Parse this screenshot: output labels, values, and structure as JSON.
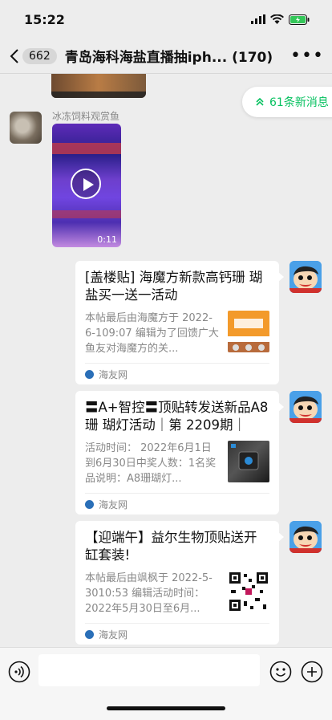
{
  "status": {
    "time": "15:22"
  },
  "nav": {
    "back_count": "662",
    "title": "青岛海科海盐直播抽iph... (170)",
    "more": "•••"
  },
  "new_messages": {
    "label": "61条新消息"
  },
  "video_message": {
    "sender": "冰冻饲料观赏鱼",
    "duration": "0:11"
  },
  "cards": [
    {
      "title": "[盖楼贴] 海魔方新款高钙珊 瑚盐买一送一活动",
      "desc": "本帖最后由海魔方于 2022-6-109:07 编辑为了回馈广大鱼友对海魔方的关...",
      "source": "海友网"
    },
    {
      "title": "〓A+智控〓顶贴转发送新品A8珊 瑚灯活动｜第 2209期｜",
      "desc": "活动时间： 2022年6月1日到6月30日中奖人数：1名奖品说明：A8珊瑚灯...",
      "source": "海友网"
    },
    {
      "title": "【迎端午】益尔生物顶贴送开缸套装!",
      "desc": "本帖最后由飒枫于 2022-5-3010:53 编辑活动时间：2022年5月30日至6月...",
      "source": "海友网"
    }
  ],
  "colors": {
    "accent": "#07c160",
    "background": "#ededed"
  }
}
